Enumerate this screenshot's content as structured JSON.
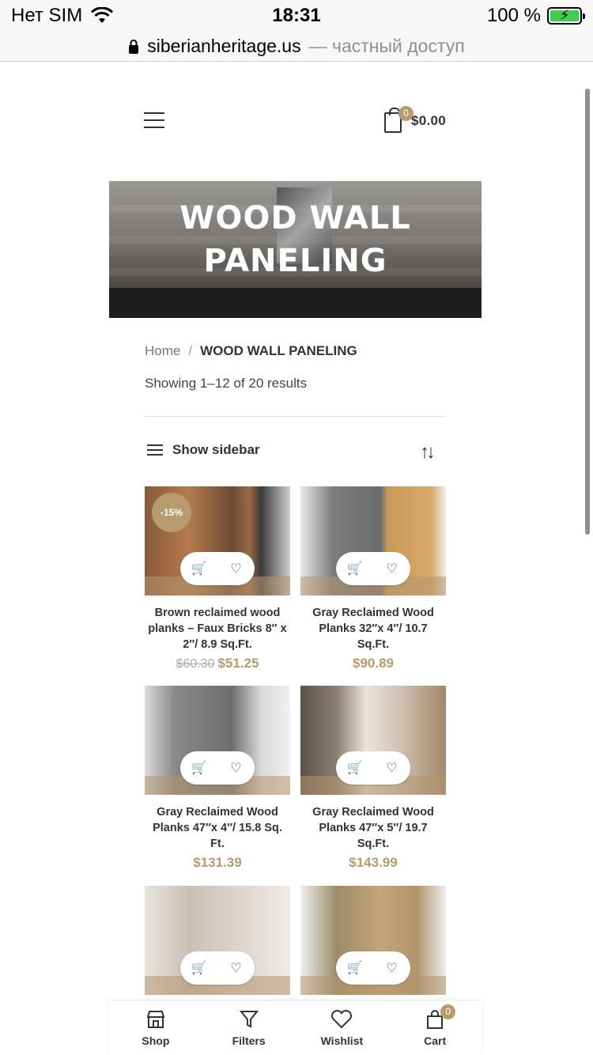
{
  "status_bar": {
    "carrier": "Нет SIM",
    "time": "18:31",
    "battery": "100 %"
  },
  "browser": {
    "host": "siberianheritage.us",
    "suffix": "— частный доступ"
  },
  "header": {
    "cart_count": "0",
    "cart_total": "$0.00"
  },
  "banner": {
    "title_line1": "WOOD WALL",
    "title_line2": "PANELING"
  },
  "breadcrumb": {
    "home": "Home",
    "separator": "/",
    "current": "WOOD WALL PANELING"
  },
  "results_text": "Showing 1–12 of 20 results",
  "toolbar": {
    "sidebar_label": "Show sidebar"
  },
  "products": [
    {
      "name": "Brown reclaimed wood planks – Faux Bricks 8″ x 2″/ 8.9 Sq.Ft.",
      "old_price": "$60.30",
      "price": "$51.25",
      "badge": "-15%"
    },
    {
      "name": "Gray Reclaimed Wood Planks 32″x 4″/ 10.7 Sq.Ft.",
      "price": "$90.89"
    },
    {
      "name": "Gray Reclaimed Wood Planks 47″x 4″/ 15.8 Sq. Ft.",
      "price": "$131.39"
    },
    {
      "name": "Gray Reclaimed Wood Planks 47″x 5″/ 19.7 Sq.Ft.",
      "price": "$143.99"
    },
    {
      "name": "",
      "price": ""
    },
    {
      "name": "",
      "price": ""
    }
  ],
  "bottom_nav": [
    {
      "label": "Shop",
      "icon": "store-icon"
    },
    {
      "label": "Filters",
      "icon": "filter-icon"
    },
    {
      "label": "Wishlist",
      "icon": "heart-icon"
    },
    {
      "label": "Cart",
      "icon": "cart-icon",
      "badge": "0"
    }
  ],
  "colors": {
    "accent": "#b79a6d",
    "text": "#333333"
  }
}
